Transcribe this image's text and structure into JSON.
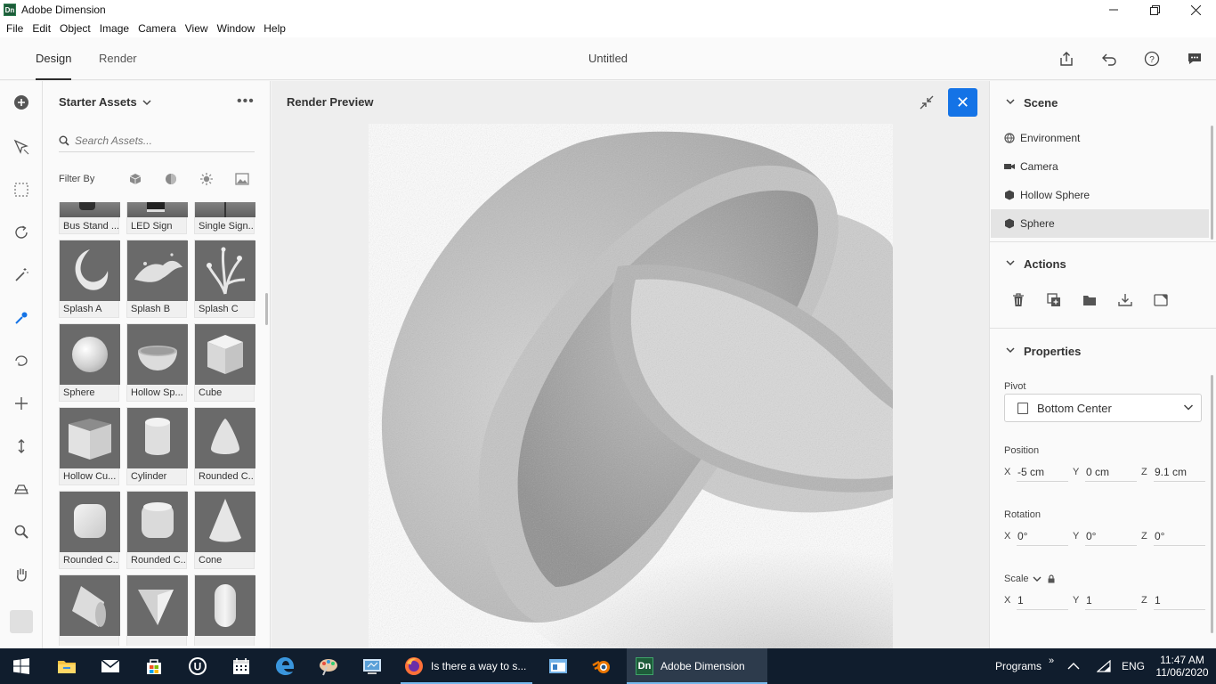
{
  "window": {
    "app_icon": "Dn",
    "title": "Adobe Dimension",
    "controls": [
      "minimize",
      "restore",
      "close"
    ]
  },
  "menu": [
    "File",
    "Edit",
    "Object",
    "Image",
    "Camera",
    "View",
    "Window",
    "Help"
  ],
  "top": {
    "tabs": [
      "Design",
      "Render"
    ],
    "active_tab": "Design",
    "doc_title": "Untitled",
    "icons": [
      "share-icon",
      "undo-icon",
      "help-icon",
      "feedback-icon"
    ]
  },
  "tools": [
    "add-icon",
    "select-move-icon",
    "marquee-select-icon",
    "orbit-icon",
    "magic-wand-icon",
    "sample-color-icon",
    "rotate-icon",
    "pan-icon",
    "dolly-icon",
    "horizon-icon",
    "zoom-icon",
    "hand-icon"
  ],
  "assets": {
    "title": "Starter Assets",
    "search_placeholder": "Search Assets...",
    "filter_label": "Filter By",
    "filter_icons": [
      "models-filter-icon",
      "materials-filter-icon",
      "lights-filter-icon",
      "images-filter-icon"
    ],
    "items": [
      {
        "label": "Bus Stand ..."
      },
      {
        "label": "LED Sign"
      },
      {
        "label": "Single Sign..."
      },
      {
        "label": "Splash A"
      },
      {
        "label": "Splash B"
      },
      {
        "label": "Splash C"
      },
      {
        "label": "Sphere"
      },
      {
        "label": "Hollow Sp..."
      },
      {
        "label": "Cube"
      },
      {
        "label": "Hollow Cu..."
      },
      {
        "label": "Cylinder"
      },
      {
        "label": "Rounded C..."
      },
      {
        "label": "Rounded C..."
      },
      {
        "label": "Rounded C..."
      },
      {
        "label": "Cone"
      },
      {
        "label": ""
      },
      {
        "label": ""
      },
      {
        "label": ""
      }
    ]
  },
  "preview": {
    "title": "Render Preview",
    "close_label": "✕"
  },
  "scene": {
    "title": "Scene",
    "items": [
      {
        "label": "Environment",
        "icon": "globe-icon"
      },
      {
        "label": "Camera",
        "icon": "camera-icon"
      },
      {
        "label": "Hollow Sphere",
        "icon": "model-icon"
      },
      {
        "label": "Sphere",
        "icon": "model-icon",
        "selected": true
      }
    ]
  },
  "actions": {
    "title": "Actions",
    "icons": [
      "delete-icon",
      "duplicate-icon",
      "group-folder-icon",
      "drop-to-ground-icon",
      "export-selected-icon"
    ]
  },
  "properties": {
    "title": "Properties",
    "pivot_label": "Pivot",
    "pivot_value": "Bottom Center",
    "position_label": "Position",
    "position": {
      "x": "-5 cm",
      "y": "0 cm",
      "z": "9.1 cm"
    },
    "rotation_label": "Rotation",
    "rotation": {
      "x": "0°",
      "y": "0°",
      "z": "0°"
    },
    "scale_label": "Scale",
    "scale": {
      "x": "1",
      "y": "1",
      "z": "1"
    },
    "axis": {
      "x": "X",
      "y": "Y",
      "z": "Z"
    }
  },
  "taskbar": {
    "tasks": [
      {
        "label": "Is there a way to s...",
        "icon": "firefox-icon"
      },
      {
        "label": "Adobe Dimension",
        "icon": "dimension-icon",
        "active": true
      }
    ],
    "tray": {
      "programs": "Programs",
      "lang": "ENG",
      "time": "11:47 AM",
      "date": "11/06/2020"
    }
  },
  "colors": {
    "accent": "#1473e6",
    "taskbar": "#101d2d",
    "panel": "#fafafa"
  }
}
